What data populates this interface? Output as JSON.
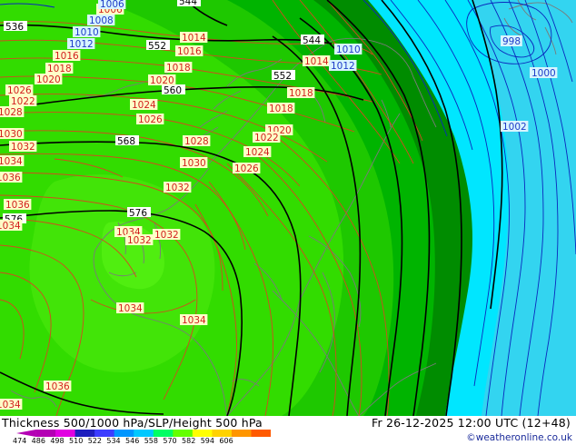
{
  "footer": {
    "title": "Thickness 500/1000 hPa/SLP/Height 500 hPa",
    "datetime": "Fr 26-12-2025 12:00 UTC (12+48)",
    "credit": "©weatheronline.co.uk",
    "scale_ticks": [
      "474",
      "486",
      "498",
      "510",
      "522",
      "534",
      "546",
      "558",
      "570",
      "582",
      "594",
      "606"
    ],
    "scale_colors": [
      "#b400b4",
      "#e100e1",
      "#1e1ebe",
      "#3c3cff",
      "#0096ff",
      "#00c8ff",
      "#00ff64",
      "#64ff00",
      "#ffff00",
      "#ffd200",
      "#ff9600",
      "#ff5a00"
    ]
  },
  "map": {
    "colors": {
      "far_cyan": "#33d4f0",
      "cyan": "#00e6ff",
      "deep_green": "#008c00",
      "green": "#00b400",
      "mid_green": "#1ec800",
      "light_green": "#32dc00",
      "brightest_green": "#50ee10",
      "slp_contour": "#d24b1e",
      "height_contour": "#000000",
      "slp_low_contour": "#0a28be",
      "coast": "#7a7a7a"
    },
    "height_labels": [
      "544",
      "536",
      "552",
      "552",
      "560",
      "568",
      "576",
      "576",
      "544"
    ],
    "slp_labels": {
      "red": [
        "1006",
        "1014",
        "1014",
        "1016",
        "1016",
        "1018",
        "1018",
        "1018",
        "1020",
        "1020",
        "1022",
        "1024",
        "1026",
        "1028",
        "1030",
        "1032",
        "1034",
        "1036",
        "1024",
        "1026",
        "1020",
        "1022",
        "1018",
        "1016",
        "1014",
        "1024",
        "1022",
        "1020",
        "1026",
        "1028",
        "1030",
        "1032",
        "1032",
        "1032",
        "1034",
        "1034",
        "1034",
        "1036",
        "1022",
        "1024",
        "1026",
        "1028",
        "1030",
        "1032",
        "1034",
        "1034",
        "1036",
        "1034",
        "1022",
        "1024",
        "1026",
        "1028",
        "1030",
        "1032"
      ],
      "blue": [
        "1008",
        "1010",
        "1012",
        "1012",
        "1010",
        "1012",
        "998",
        "1000",
        "1002"
      ]
    }
  }
}
